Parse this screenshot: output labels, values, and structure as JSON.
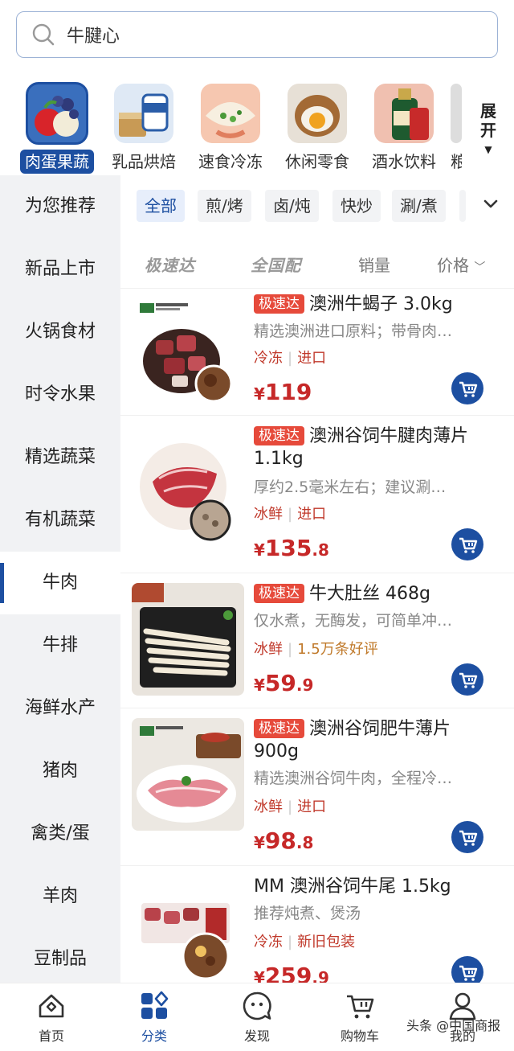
{
  "search": {
    "query": "牛腱心"
  },
  "top_categories": [
    {
      "label": "肉蛋果蔬",
      "active": true
    },
    {
      "label": "乳品烘焙",
      "active": false
    },
    {
      "label": "速食冷冻",
      "active": false
    },
    {
      "label": "休闲零食",
      "active": false
    },
    {
      "label": "酒水饮料",
      "active": false
    },
    {
      "label": "粮",
      "active": false
    }
  ],
  "expand_label": "展开",
  "sidebar": {
    "items": [
      {
        "label": "为您推荐"
      },
      {
        "label": "新品上市"
      },
      {
        "label": "火锅食材"
      },
      {
        "label": "时令水果"
      },
      {
        "label": "精选蔬菜"
      },
      {
        "label": "有机蔬菜"
      },
      {
        "label": "牛肉",
        "active": true
      },
      {
        "label": "牛排"
      },
      {
        "label": "海鲜水产"
      },
      {
        "label": "猪肉"
      },
      {
        "label": "禽类/蛋"
      },
      {
        "label": "羊肉"
      },
      {
        "label": "豆制品"
      }
    ]
  },
  "chips": [
    {
      "label": "全部",
      "active": true
    },
    {
      "label": "煎/烤"
    },
    {
      "label": "卤/炖"
    },
    {
      "label": "快炒"
    },
    {
      "label": "涮/煮"
    }
  ],
  "sort": {
    "fast": "极速达",
    "national": "全国配",
    "sales": "销量",
    "price": "价格"
  },
  "products": [
    {
      "tag": "极速达",
      "title": "澳洲牛蝎子 3.0kg",
      "desc": "精选澳洲进口原料；带骨肉…",
      "attr1": "冷冻",
      "attr2": "进口",
      "price_int": "119",
      "price_dec": "",
      "currency": "¥"
    },
    {
      "tag": "极速达",
      "title": "澳洲谷饲牛腱肉薄片 1.1kg",
      "desc": "厚约2.5毫米左右；建议涮…",
      "attr1": "冰鲜",
      "attr2": "进口",
      "price_int": "135",
      "price_dec": ".8",
      "currency": "¥"
    },
    {
      "tag": "极速达",
      "title": "牛大肚丝 468g",
      "desc": "仅水煮，无酶发，可简单冲…",
      "attr1": "冰鲜",
      "attr2": "1.5万条好评",
      "price_int": "59",
      "price_dec": ".9",
      "currency": "¥"
    },
    {
      "tag": "极速达",
      "title": "澳洲谷饲肥牛薄片 900g",
      "desc": "精选澳洲谷饲牛肉，全程冷…",
      "attr1": "冰鲜",
      "attr2": "进口",
      "price_int": "98",
      "price_dec": ".8",
      "currency": "¥"
    },
    {
      "tag": "",
      "title": "MM 澳洲谷饲牛尾 1.5kg",
      "desc": "推荐炖煮、煲汤",
      "attr1": "冷冻",
      "attr2": "新旧包装",
      "price_int": "259",
      "price_dec": ".9",
      "currency": "¥"
    }
  ],
  "bottom_nav": [
    {
      "label": "首页"
    },
    {
      "label": "分类",
      "active": true
    },
    {
      "label": "发现"
    },
    {
      "label": "购物车"
    },
    {
      "label": "我的"
    }
  ],
  "watermark": "头条 @中国商报",
  "colors": {
    "brand_blue": "#1d4fa1",
    "price_red": "#c62828",
    "tag_red": "#e64a3b"
  }
}
